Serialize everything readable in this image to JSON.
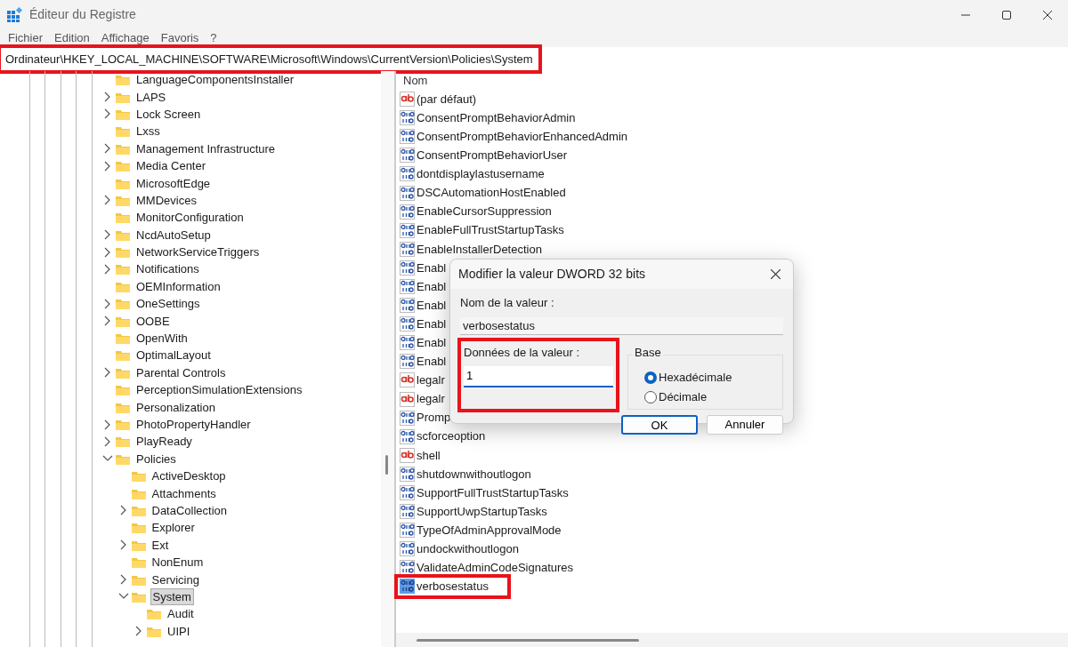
{
  "window": {
    "title": "Éditeur du Registre"
  },
  "menu": [
    "Fichier",
    "Edition",
    "Affichage",
    "Favoris",
    "?"
  ],
  "address_bar": {
    "value": "Ordinateur\\HKEY_LOCAL_MACHINE\\SOFTWARE\\Microsoft\\Windows\\CurrentVersion\\Policies\\System",
    "highlighted": true
  },
  "tree": [
    {
      "label": "LanguageComponentsInstaller",
      "selected": false
    },
    {
      "label": "LAPS",
      "expanded": false,
      "selected": false
    },
    {
      "label": "Lock Screen",
      "expanded": false,
      "selected": false
    },
    {
      "label": "Lxss",
      "selected": false
    },
    {
      "label": "Management Infrastructure",
      "expanded": false,
      "selected": false
    },
    {
      "label": "Media Center",
      "expanded": false,
      "selected": false
    },
    {
      "label": "MicrosoftEdge",
      "selected": false
    },
    {
      "label": "MMDevices",
      "expanded": false,
      "selected": false
    },
    {
      "label": "MonitorConfiguration",
      "selected": false
    },
    {
      "label": "NcdAutoSetup",
      "expanded": false,
      "selected": false
    },
    {
      "label": "NetworkServiceTriggers",
      "expanded": false,
      "selected": false
    },
    {
      "label": "Notifications",
      "expanded": false,
      "selected": false
    },
    {
      "label": "OEMInformation",
      "selected": false
    },
    {
      "label": "OneSettings",
      "expanded": false,
      "selected": false
    },
    {
      "label": "OOBE",
      "expanded": false,
      "selected": false
    },
    {
      "label": "OpenWith",
      "selected": false
    },
    {
      "label": "OptimalLayout",
      "selected": false
    },
    {
      "label": "Parental Controls",
      "expanded": false,
      "selected": false
    },
    {
      "label": "PerceptionSimulationExtensions",
      "selected": false
    },
    {
      "label": "Personalization",
      "selected": false
    },
    {
      "label": "PhotoPropertyHandler",
      "expanded": false,
      "selected": false
    },
    {
      "label": "PlayReady",
      "expanded": false,
      "selected": false
    },
    {
      "label": "Policies",
      "expanded": true,
      "selected": false,
      "children": [
        {
          "label": "ActiveDesktop",
          "selected": false
        },
        {
          "label": "Attachments",
          "selected": false
        },
        {
          "label": "DataCollection",
          "expanded": false,
          "selected": false
        },
        {
          "label": "Explorer",
          "selected": false
        },
        {
          "label": "Ext",
          "expanded": false,
          "selected": false
        },
        {
          "label": "NonEnum",
          "selected": false
        },
        {
          "label": "Servicing",
          "expanded": false,
          "selected": false
        },
        {
          "label": "System",
          "expanded": true,
          "selected": true,
          "children": [
            {
              "label": "Audit",
              "selected": false
            },
            {
              "label": "UIPI",
              "expanded": false,
              "selected": false
            }
          ]
        }
      ]
    }
  ],
  "values": {
    "columns": [
      "Nom"
    ],
    "rows": [
      {
        "name": "(par défaut)",
        "kind": "sz",
        "selected": false,
        "highlighted": false
      },
      {
        "name": "ConsentPromptBehaviorAdmin",
        "kind": "dword",
        "selected": false,
        "highlighted": false
      },
      {
        "name": "ConsentPromptBehaviorEnhancedAdmin",
        "kind": "dword",
        "selected": false,
        "highlighted": false
      },
      {
        "name": "ConsentPromptBehaviorUser",
        "kind": "dword",
        "selected": false,
        "highlighted": false
      },
      {
        "name": "dontdisplaylastusername",
        "kind": "dword",
        "selected": false,
        "highlighted": false
      },
      {
        "name": "DSCAutomationHostEnabled",
        "kind": "dword",
        "selected": false,
        "highlighted": false
      },
      {
        "name": "EnableCursorSuppression",
        "kind": "dword",
        "selected": false,
        "highlighted": false
      },
      {
        "name": "EnableFullTrustStartupTasks",
        "kind": "dword",
        "selected": false,
        "highlighted": false
      },
      {
        "name": "EnableInstallerDetection",
        "kind": "dword",
        "selected": false,
        "highlighted": false
      },
      {
        "name": "Enabl",
        "kind": "dword",
        "selected": false,
        "highlighted": false
      },
      {
        "name": "Enabl",
        "kind": "dword",
        "selected": false,
        "highlighted": false
      },
      {
        "name": "Enabl",
        "kind": "dword",
        "selected": false,
        "highlighted": false
      },
      {
        "name": "Enabl",
        "kind": "dword",
        "selected": false,
        "highlighted": false
      },
      {
        "name": "Enabl",
        "kind": "dword",
        "selected": false,
        "highlighted": false
      },
      {
        "name": "Enabl",
        "kind": "dword",
        "selected": false,
        "highlighted": false
      },
      {
        "name": "legalr",
        "kind": "sz",
        "selected": false,
        "highlighted": false
      },
      {
        "name": "legalr",
        "kind": "sz",
        "selected": false,
        "highlighted": false
      },
      {
        "name": "Promp",
        "kind": "dword",
        "selected": false,
        "highlighted": false
      },
      {
        "name": "scforceoption",
        "kind": "dword",
        "selected": false,
        "highlighted": false
      },
      {
        "name": "shell",
        "kind": "sz",
        "selected": false,
        "highlighted": false
      },
      {
        "name": "shutdownwithoutlogon",
        "kind": "dword",
        "selected": false,
        "highlighted": false
      },
      {
        "name": "SupportFullTrustStartupTasks",
        "kind": "dword",
        "selected": false,
        "highlighted": false
      },
      {
        "name": "SupportUwpStartupTasks",
        "kind": "dword",
        "selected": false,
        "highlighted": false
      },
      {
        "name": "TypeOfAdminApprovalMode",
        "kind": "dword",
        "selected": false,
        "highlighted": false
      },
      {
        "name": "undockwithoutlogon",
        "kind": "dword",
        "selected": false,
        "highlighted": false
      },
      {
        "name": "ValidateAdminCodeSignatures",
        "kind": "dword",
        "selected": false,
        "highlighted": false
      },
      {
        "name": "verbosestatus",
        "kind": "dword",
        "selected": true,
        "highlighted": true
      }
    ]
  },
  "dialog": {
    "title": "Modifier la valeur DWORD 32 bits",
    "name_label": "Nom de la valeur :",
    "name_value": "verbosestatus",
    "data_label": "Données de la valeur :",
    "data_value": "1",
    "data_highlighted": true,
    "base_label": "Base",
    "radios": [
      {
        "label": "Hexadécimale",
        "selected": true
      },
      {
        "label": "Décimale",
        "selected": false
      }
    ],
    "buttons": [
      {
        "label": "OK",
        "default": true
      },
      {
        "label": "Annuler",
        "default": false
      }
    ]
  }
}
